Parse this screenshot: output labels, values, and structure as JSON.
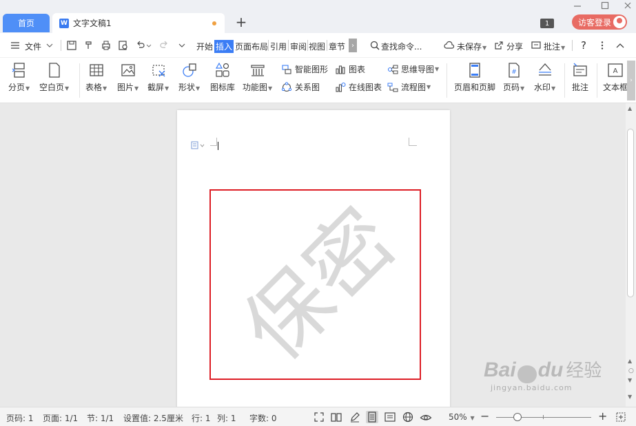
{
  "tabs": {
    "home": "首页",
    "doc_title": "文字文稿1",
    "doc_icon": "W",
    "add": "+"
  },
  "topbar": {
    "count_badge": "1",
    "login": "访客登录"
  },
  "menu": {
    "file": "文件",
    "tabs": [
      "开始",
      "插入",
      "页面布局",
      "引用",
      "审阅",
      "视图",
      "章节"
    ],
    "active_tab": "插入",
    "search": "查找命令...",
    "unsaved": "未保存",
    "share": "分享",
    "comment": "批注",
    "help": "?"
  },
  "ribbon": {
    "page_break": "分页",
    "blank_page": "空白页",
    "table": "表格",
    "picture": "图片",
    "screenshot": "截屏",
    "shape": "形状",
    "icon_lib": "图标库",
    "func_chart": "功能图",
    "smart_art": "智能图形",
    "chart": "图表",
    "mind_map": "思维导图",
    "relation": "关系图",
    "online_chart": "在线图表",
    "flowchart": "流程图",
    "header_footer": "页眉和页脚",
    "page_number": "页码",
    "watermark": "水印",
    "annotation": "批注",
    "textbox": "文本框"
  },
  "document": {
    "watermark_text": "保密"
  },
  "branding": {
    "logo": "Bai",
    "logo2": "du",
    "logo_cn": "经验",
    "url": "jingyan.baidu.com"
  },
  "status": {
    "page_no": "页码: 1",
    "pages": "页面: 1/1",
    "section": "节: 1/1",
    "setting": "设置值: 2.5厘米",
    "row": "行: 1",
    "col": "列: 1",
    "words": "字数: 0",
    "zoom": "50%",
    "zoom_level": 0.5
  },
  "colors": {
    "accent": "#3b7df5",
    "home_tab": "#4f8ff7",
    "login": "#e86b63",
    "highlight": "#dd1c24"
  }
}
